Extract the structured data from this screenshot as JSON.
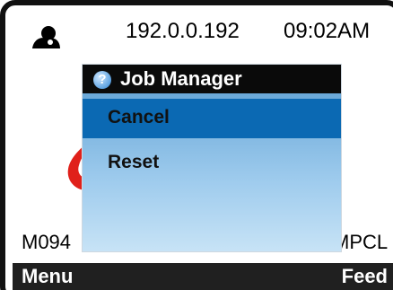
{
  "status_bar": {
    "icon": "user-icon",
    "ip_address": "192.0.0.192",
    "time": "09:02AM"
  },
  "background": {
    "model_left": "M094",
    "model_right": "MPCL",
    "accent_color": "#e0201a"
  },
  "softkeys": {
    "left_label": "Menu",
    "right_label": "Feed"
  },
  "dialog": {
    "title": "Job Manager",
    "title_icon": "help-icon",
    "title_icon_glyph": "?",
    "items": [
      {
        "label": "Cancel",
        "selected": true
      },
      {
        "label": "Reset",
        "selected": false
      }
    ]
  }
}
